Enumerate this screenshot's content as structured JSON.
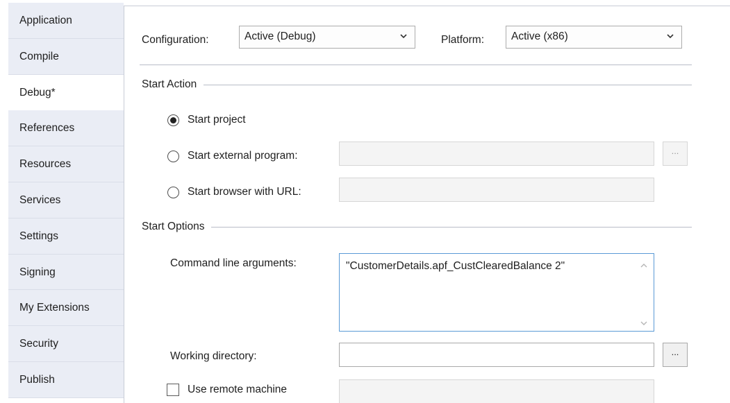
{
  "sidebar": {
    "items": [
      {
        "label": "Application"
      },
      {
        "label": "Compile"
      },
      {
        "label": "Debug*"
      },
      {
        "label": "References"
      },
      {
        "label": "Resources"
      },
      {
        "label": "Services"
      },
      {
        "label": "Settings"
      },
      {
        "label": "Signing"
      },
      {
        "label": "My Extensions"
      },
      {
        "label": "Security"
      },
      {
        "label": "Publish"
      }
    ],
    "active": "Debug*"
  },
  "config": {
    "configuration_label": "Configuration:",
    "configuration_value": "Active (Debug)",
    "platform_label": "Platform:",
    "platform_value": "Active (x86)"
  },
  "start_action": {
    "title": "Start Action",
    "start_project": "Start project",
    "start_external": "Start external program:",
    "start_browser": "Start browser with URL:",
    "browse_label": "...",
    "selected": "Start project"
  },
  "start_options": {
    "title": "Start Options",
    "cmd_label": "Command line arguments:",
    "cmd_value": "\"CustomerDetails.apf_CustClearedBalance 2\"",
    "working_dir_label": "Working directory:",
    "working_dir_value": "",
    "browse_label": "...",
    "remote_label": "Use remote machine",
    "remote_checked": false
  },
  "colors": {
    "sidebar_bg": "#eaedf5",
    "focus_border": "#5a9ad6"
  }
}
